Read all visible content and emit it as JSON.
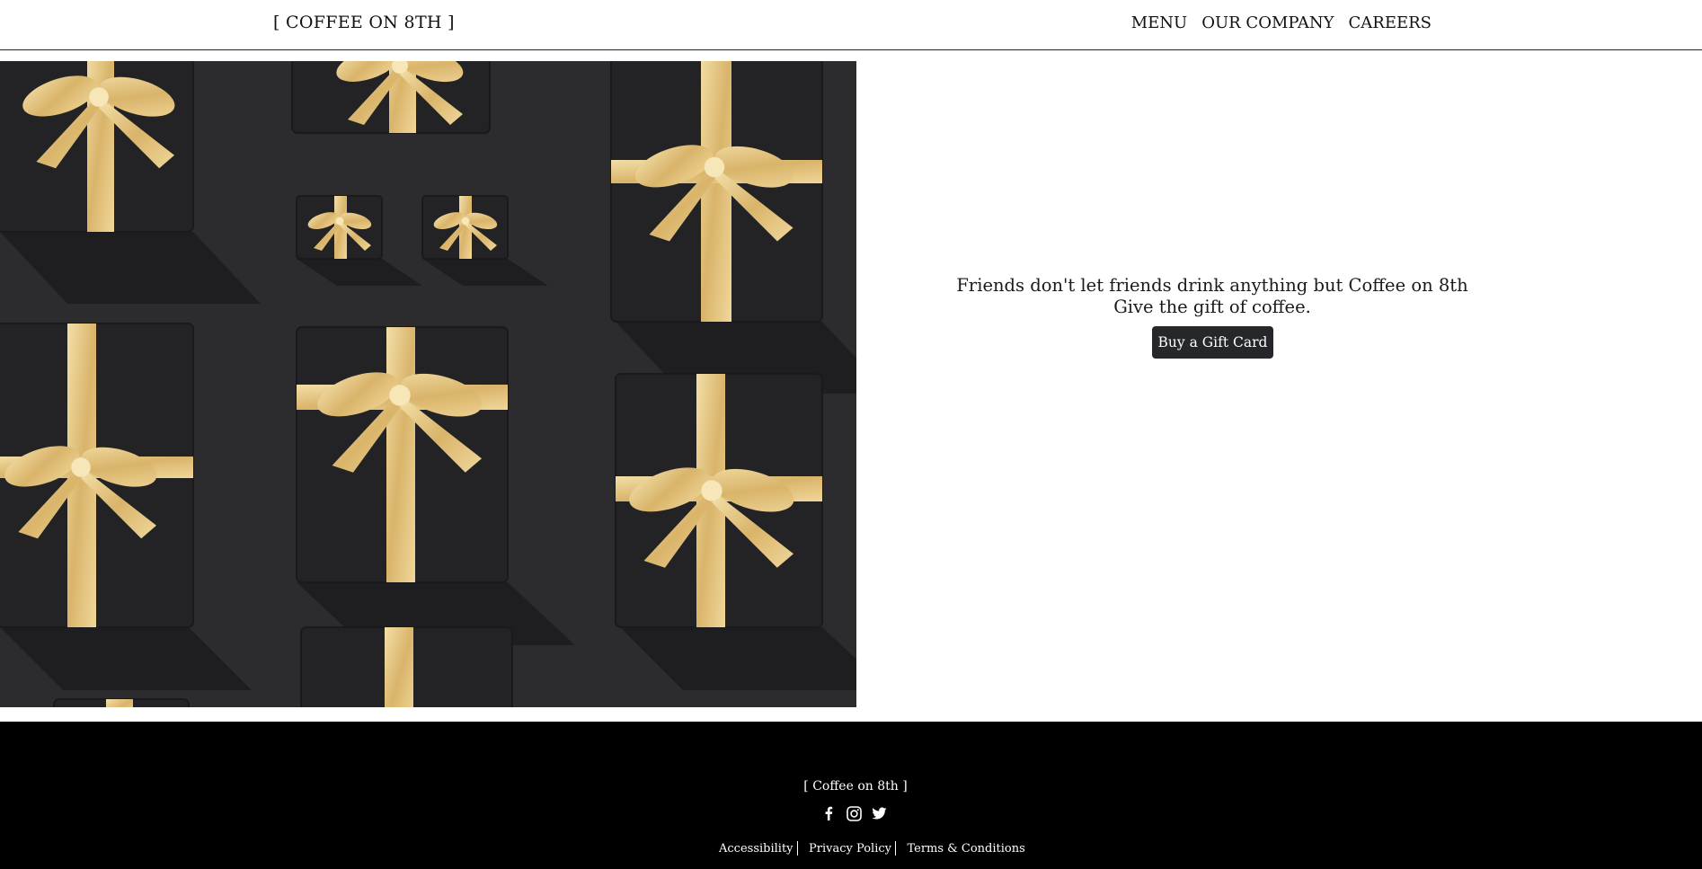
{
  "header": {
    "logo": "[ COFFEE ON 8TH ]",
    "nav": [
      "MENU",
      "OUR COMPANY",
      "CAREERS"
    ]
  },
  "hero": {
    "image_description": "Black gift boxes tied with gold satin ribbons on a dark background"
  },
  "promo": {
    "line1": "Friends don't let friends drink anything but Coffee on 8th",
    "line2": "Give the gift of coffee.",
    "button_label": "Buy a Gift Card"
  },
  "footer": {
    "brand": "[ Coffee on 8th ]",
    "social_icons": [
      "facebook-icon",
      "instagram-icon",
      "twitter-icon"
    ],
    "links": [
      "Accessibility",
      "Privacy Policy",
      "Terms & Conditions"
    ]
  },
  "colors": {
    "header_border": "#222222",
    "hero_background": "#2c2c2f",
    "gift_box": "#232326",
    "ribbon": "#e2c27e",
    "button_bg": "#25272b",
    "footer_bg": "#000000",
    "text": "#1a1a1a"
  }
}
